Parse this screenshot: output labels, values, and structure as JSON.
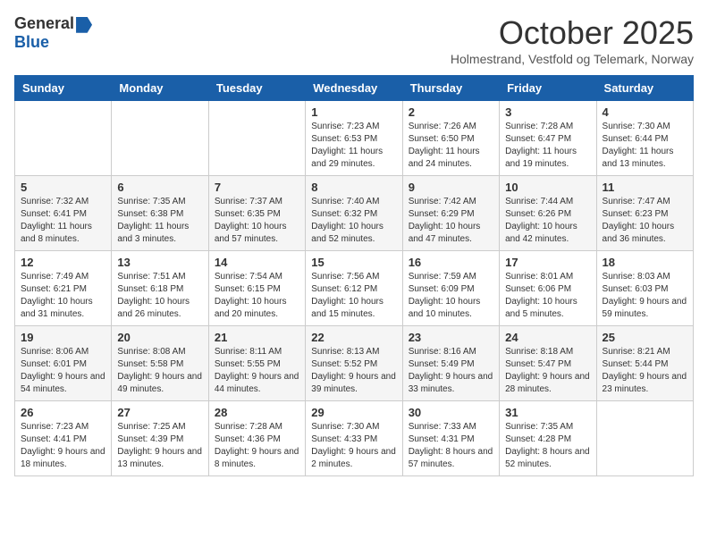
{
  "logo": {
    "general": "General",
    "blue": "Blue"
  },
  "header": {
    "month": "October 2025",
    "location": "Holmestrand, Vestfold og Telemark, Norway"
  },
  "weekdays": [
    "Sunday",
    "Monday",
    "Tuesday",
    "Wednesday",
    "Thursday",
    "Friday",
    "Saturday"
  ],
  "weeks": [
    [
      {
        "day": "",
        "sunrise": "",
        "sunset": "",
        "daylight": ""
      },
      {
        "day": "",
        "sunrise": "",
        "sunset": "",
        "daylight": ""
      },
      {
        "day": "",
        "sunrise": "",
        "sunset": "",
        "daylight": ""
      },
      {
        "day": "1",
        "sunrise": "Sunrise: 7:23 AM",
        "sunset": "Sunset: 6:53 PM",
        "daylight": "Daylight: 11 hours and 29 minutes."
      },
      {
        "day": "2",
        "sunrise": "Sunrise: 7:26 AM",
        "sunset": "Sunset: 6:50 PM",
        "daylight": "Daylight: 11 hours and 24 minutes."
      },
      {
        "day": "3",
        "sunrise": "Sunrise: 7:28 AM",
        "sunset": "Sunset: 6:47 PM",
        "daylight": "Daylight: 11 hours and 19 minutes."
      },
      {
        "day": "4",
        "sunrise": "Sunrise: 7:30 AM",
        "sunset": "Sunset: 6:44 PM",
        "daylight": "Daylight: 11 hours and 13 minutes."
      }
    ],
    [
      {
        "day": "5",
        "sunrise": "Sunrise: 7:32 AM",
        "sunset": "Sunset: 6:41 PM",
        "daylight": "Daylight: 11 hours and 8 minutes."
      },
      {
        "day": "6",
        "sunrise": "Sunrise: 7:35 AM",
        "sunset": "Sunset: 6:38 PM",
        "daylight": "Daylight: 11 hours and 3 minutes."
      },
      {
        "day": "7",
        "sunrise": "Sunrise: 7:37 AM",
        "sunset": "Sunset: 6:35 PM",
        "daylight": "Daylight: 10 hours and 57 minutes."
      },
      {
        "day": "8",
        "sunrise": "Sunrise: 7:40 AM",
        "sunset": "Sunset: 6:32 PM",
        "daylight": "Daylight: 10 hours and 52 minutes."
      },
      {
        "day": "9",
        "sunrise": "Sunrise: 7:42 AM",
        "sunset": "Sunset: 6:29 PM",
        "daylight": "Daylight: 10 hours and 47 minutes."
      },
      {
        "day": "10",
        "sunrise": "Sunrise: 7:44 AM",
        "sunset": "Sunset: 6:26 PM",
        "daylight": "Daylight: 10 hours and 42 minutes."
      },
      {
        "day": "11",
        "sunrise": "Sunrise: 7:47 AM",
        "sunset": "Sunset: 6:23 PM",
        "daylight": "Daylight: 10 hours and 36 minutes."
      }
    ],
    [
      {
        "day": "12",
        "sunrise": "Sunrise: 7:49 AM",
        "sunset": "Sunset: 6:21 PM",
        "daylight": "Daylight: 10 hours and 31 minutes."
      },
      {
        "day": "13",
        "sunrise": "Sunrise: 7:51 AM",
        "sunset": "Sunset: 6:18 PM",
        "daylight": "Daylight: 10 hours and 26 minutes."
      },
      {
        "day": "14",
        "sunrise": "Sunrise: 7:54 AM",
        "sunset": "Sunset: 6:15 PM",
        "daylight": "Daylight: 10 hours and 20 minutes."
      },
      {
        "day": "15",
        "sunrise": "Sunrise: 7:56 AM",
        "sunset": "Sunset: 6:12 PM",
        "daylight": "Daylight: 10 hours and 15 minutes."
      },
      {
        "day": "16",
        "sunrise": "Sunrise: 7:59 AM",
        "sunset": "Sunset: 6:09 PM",
        "daylight": "Daylight: 10 hours and 10 minutes."
      },
      {
        "day": "17",
        "sunrise": "Sunrise: 8:01 AM",
        "sunset": "Sunset: 6:06 PM",
        "daylight": "Daylight: 10 hours and 5 minutes."
      },
      {
        "day": "18",
        "sunrise": "Sunrise: 8:03 AM",
        "sunset": "Sunset: 6:03 PM",
        "daylight": "Daylight: 9 hours and 59 minutes."
      }
    ],
    [
      {
        "day": "19",
        "sunrise": "Sunrise: 8:06 AM",
        "sunset": "Sunset: 6:01 PM",
        "daylight": "Daylight: 9 hours and 54 minutes."
      },
      {
        "day": "20",
        "sunrise": "Sunrise: 8:08 AM",
        "sunset": "Sunset: 5:58 PM",
        "daylight": "Daylight: 9 hours and 49 minutes."
      },
      {
        "day": "21",
        "sunrise": "Sunrise: 8:11 AM",
        "sunset": "Sunset: 5:55 PM",
        "daylight": "Daylight: 9 hours and 44 minutes."
      },
      {
        "day": "22",
        "sunrise": "Sunrise: 8:13 AM",
        "sunset": "Sunset: 5:52 PM",
        "daylight": "Daylight: 9 hours and 39 minutes."
      },
      {
        "day": "23",
        "sunrise": "Sunrise: 8:16 AM",
        "sunset": "Sunset: 5:49 PM",
        "daylight": "Daylight: 9 hours and 33 minutes."
      },
      {
        "day": "24",
        "sunrise": "Sunrise: 8:18 AM",
        "sunset": "Sunset: 5:47 PM",
        "daylight": "Daylight: 9 hours and 28 minutes."
      },
      {
        "day": "25",
        "sunrise": "Sunrise: 8:21 AM",
        "sunset": "Sunset: 5:44 PM",
        "daylight": "Daylight: 9 hours and 23 minutes."
      }
    ],
    [
      {
        "day": "26",
        "sunrise": "Sunrise: 7:23 AM",
        "sunset": "Sunset: 4:41 PM",
        "daylight": "Daylight: 9 hours and 18 minutes."
      },
      {
        "day": "27",
        "sunrise": "Sunrise: 7:25 AM",
        "sunset": "Sunset: 4:39 PM",
        "daylight": "Daylight: 9 hours and 13 minutes."
      },
      {
        "day": "28",
        "sunrise": "Sunrise: 7:28 AM",
        "sunset": "Sunset: 4:36 PM",
        "daylight": "Daylight: 9 hours and 8 minutes."
      },
      {
        "day": "29",
        "sunrise": "Sunrise: 7:30 AM",
        "sunset": "Sunset: 4:33 PM",
        "daylight": "Daylight: 9 hours and 2 minutes."
      },
      {
        "day": "30",
        "sunrise": "Sunrise: 7:33 AM",
        "sunset": "Sunset: 4:31 PM",
        "daylight": "Daylight: 8 hours and 57 minutes."
      },
      {
        "day": "31",
        "sunrise": "Sunrise: 7:35 AM",
        "sunset": "Sunset: 4:28 PM",
        "daylight": "Daylight: 8 hours and 52 minutes."
      },
      {
        "day": "",
        "sunrise": "",
        "sunset": "",
        "daylight": ""
      }
    ]
  ]
}
